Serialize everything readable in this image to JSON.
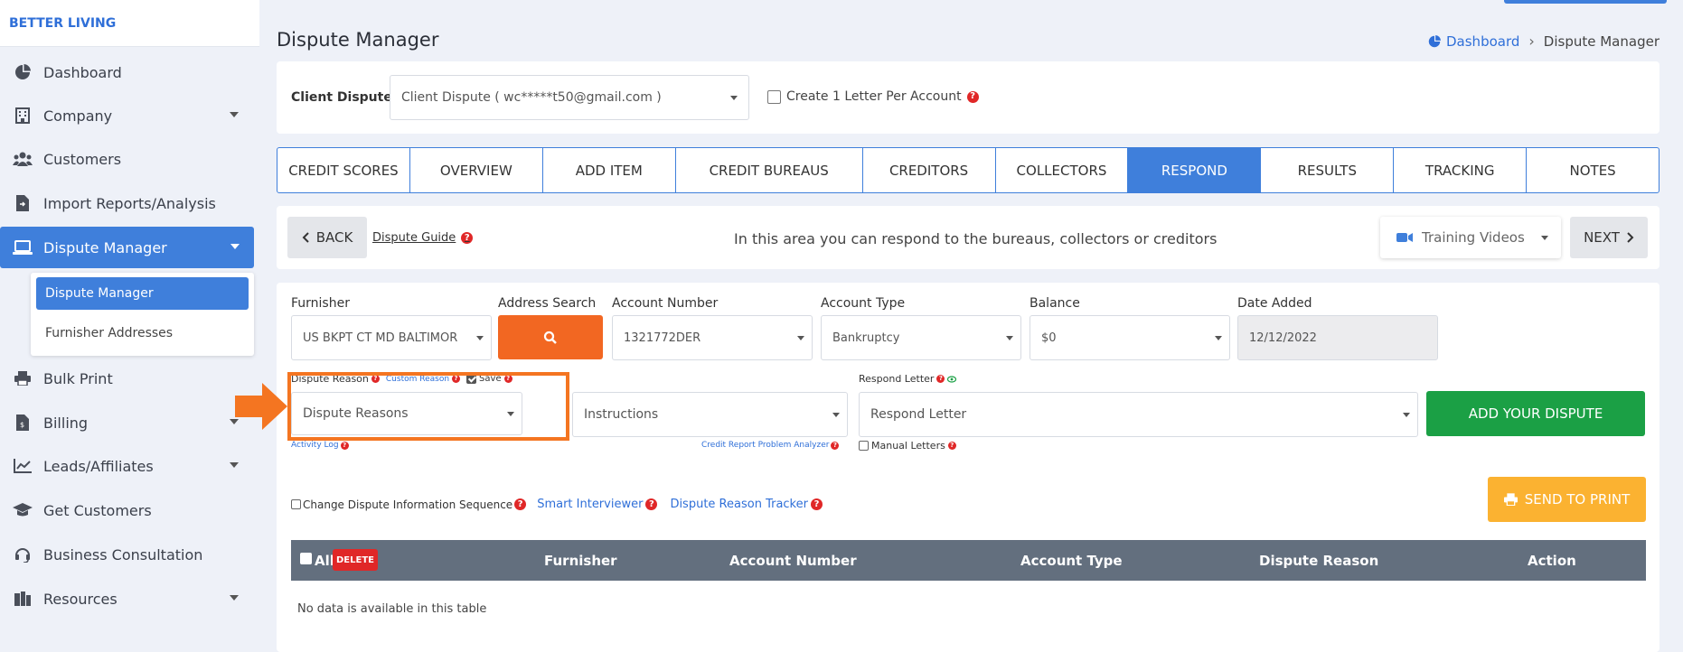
{
  "sidebar": {
    "brand": "BETTER LIVING",
    "items": [
      {
        "label": "Dashboard",
        "icon": "pie-chart-icon"
      },
      {
        "label": "Company",
        "icon": "building-icon",
        "has_caret": true
      },
      {
        "label": "Customers",
        "icon": "users-icon"
      },
      {
        "label": "Import Reports/Analysis",
        "icon": "file-import-icon"
      },
      {
        "label": "Dispute Manager",
        "icon": "laptop-icon",
        "has_caret": true,
        "active": true
      },
      {
        "label": "Bulk Print",
        "icon": "printer-icon"
      },
      {
        "label": "Billing",
        "icon": "invoice-icon",
        "has_caret": true
      },
      {
        "label": "Leads/Affiliates",
        "icon": "chart-line-icon",
        "has_caret": true
      },
      {
        "label": "Get Customers",
        "icon": "graduation-cap-icon"
      },
      {
        "label": "Business Consultation",
        "icon": "headset-icon"
      },
      {
        "label": "Resources",
        "icon": "book-icon",
        "has_caret": true
      }
    ],
    "submenu": [
      {
        "label": "Dispute Manager",
        "active": true
      },
      {
        "label": "Furnisher Addresses"
      }
    ]
  },
  "header": {
    "title": "Dispute Manager",
    "breadcrumb": {
      "home": "Dashboard",
      "current": "Dispute Manager"
    }
  },
  "client": {
    "label": "Client Dispute",
    "selected": "Client Dispute ( wc*****t50@gmail.com )",
    "create_letter_label": "Create 1 Letter Per Account"
  },
  "tabs": [
    {
      "label": "CREDIT SCORES"
    },
    {
      "label": "OVERVIEW"
    },
    {
      "label": "ADD ITEM"
    },
    {
      "label": "CREDIT BUREAUS"
    },
    {
      "label": "CREDITORS"
    },
    {
      "label": "COLLECTORS"
    },
    {
      "label": "RESPOND",
      "active": true
    },
    {
      "label": "RESULTS"
    },
    {
      "label": "TRACKING"
    },
    {
      "label": "NOTES"
    }
  ],
  "respond_bar": {
    "back": "BACK",
    "guide": "Dispute Guide",
    "message": "In this area you can respond to the bureaus, collectors or creditors",
    "training": "Training Videos",
    "next": "NEXT"
  },
  "form": {
    "furnisher": {
      "label": "Furnisher",
      "value": "US BKPT CT MD BALTIMOR"
    },
    "address_search": {
      "label": "Address Search"
    },
    "account_number": {
      "label": "Account Number",
      "value": "1321772DER"
    },
    "account_type": {
      "label": "Account Type",
      "value": "Bankruptcy"
    },
    "balance": {
      "label": "Balance",
      "value": "$0"
    },
    "date_added": {
      "label": "Date Added",
      "value": "12/12/2022"
    },
    "dispute_reason": {
      "label": "Dispute Reason",
      "custom": "Custom Reason",
      "save": "Save",
      "value": "Dispute Reasons"
    },
    "instructions": {
      "value": "Instructions"
    },
    "respond_letter": {
      "label": "Respond Letter",
      "value": "Respond Letter"
    },
    "activity_log": "Activity Log",
    "analyzer": "Credit Report Problem Analyzer",
    "manual_letters": "Manual Letters",
    "add_dispute": "ADD YOUR DISPUTE",
    "change_sequence": "Change Dispute Information Sequence",
    "smart_interviewer": "Smart Interviewer",
    "reason_tracker": "Dispute Reason Tracker",
    "send_to_print": "SEND TO PRINT"
  },
  "table": {
    "all_label": "All",
    "delete": "DELETE",
    "columns": [
      "Furnisher",
      "Account Number",
      "Account Type",
      "Dispute Reason",
      "Action"
    ],
    "empty": "No data is available in this table"
  },
  "colors": {
    "primary": "#3f7fdb",
    "orange": "#f26722",
    "green": "#1ba045",
    "yellow": "#fbb231",
    "red": "#e02727",
    "table_header": "#636f7e"
  }
}
